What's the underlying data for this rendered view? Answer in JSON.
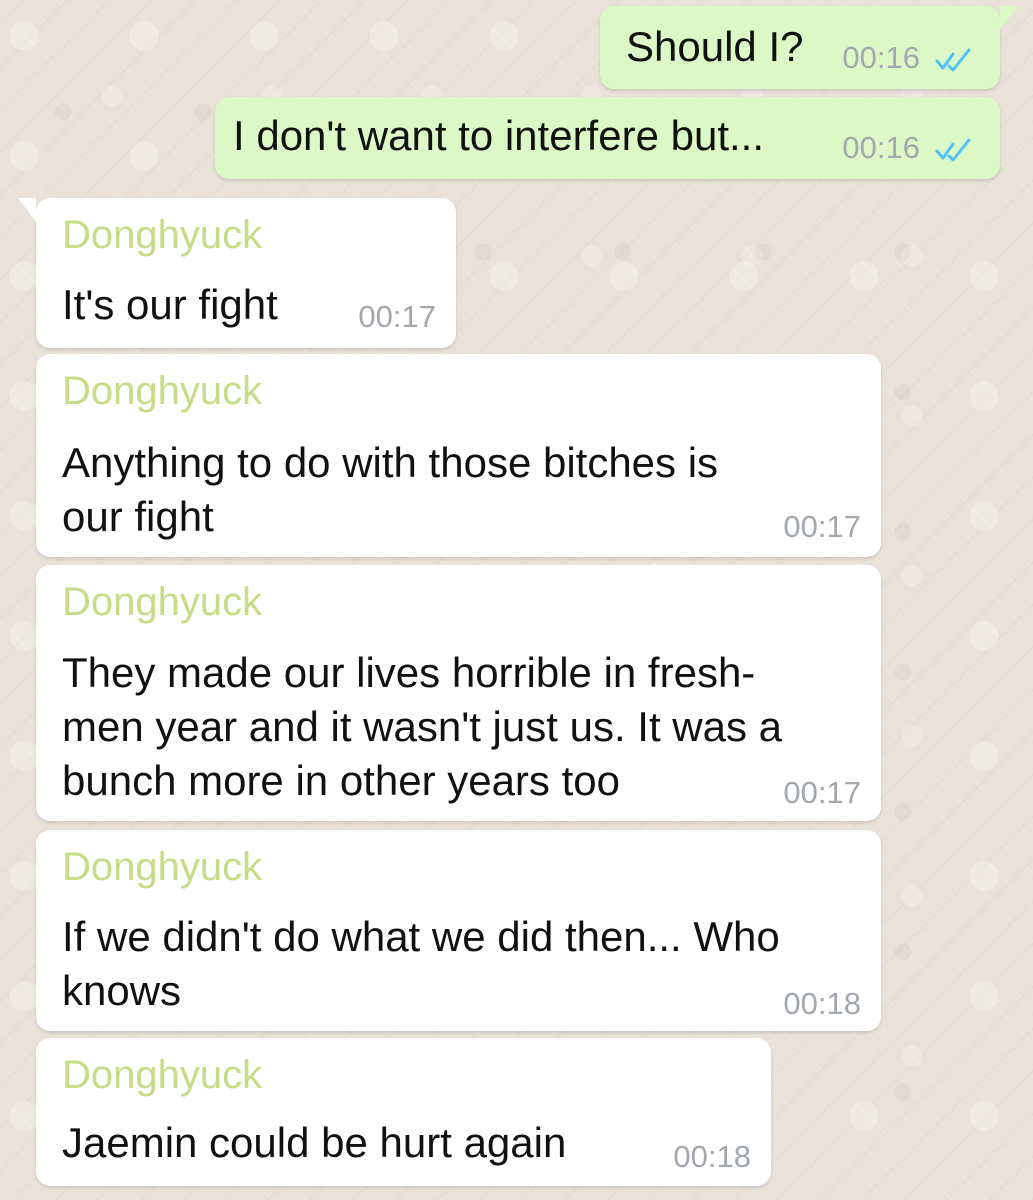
{
  "theme": {
    "background": "#e8e2d8",
    "outgoing_bubble": "#dcf8c6",
    "incoming_bubble": "#ffffff",
    "sender_name_color": "#c6dc86",
    "time_color": "#a3a8ad",
    "read_receipt_color": "#4fc3f7"
  },
  "chat": {
    "messages": [
      {
        "direction": "outgoing",
        "text": "Should I?",
        "time": "00:16",
        "read_status_icon": "double-check-blue-icon"
      },
      {
        "direction": "outgoing",
        "text": "I don't want to interfere but...",
        "time": "00:16",
        "read_status_icon": "double-check-blue-icon"
      },
      {
        "direction": "incoming",
        "sender": "Donghyuck",
        "text": "It's our fight",
        "time": "00:17"
      },
      {
        "direction": "incoming",
        "sender": "Donghyuck",
        "text": "Anything to do with those bitches is\nour fight",
        "time": "00:17"
      },
      {
        "direction": "incoming",
        "sender": "Donghyuck",
        "text": "They made our lives horrible in fresh-\nmen year and it wasn't just us. It was a\nbunch more in other years too",
        "time": "00:17"
      },
      {
        "direction": "incoming",
        "sender": "Donghyuck",
        "text": "If we didn't do what we did then... Who\nknows",
        "time": "00:18"
      },
      {
        "direction": "incoming",
        "sender": "Donghyuck",
        "text": "Jaemin could be hurt again",
        "time": "00:18"
      }
    ]
  }
}
